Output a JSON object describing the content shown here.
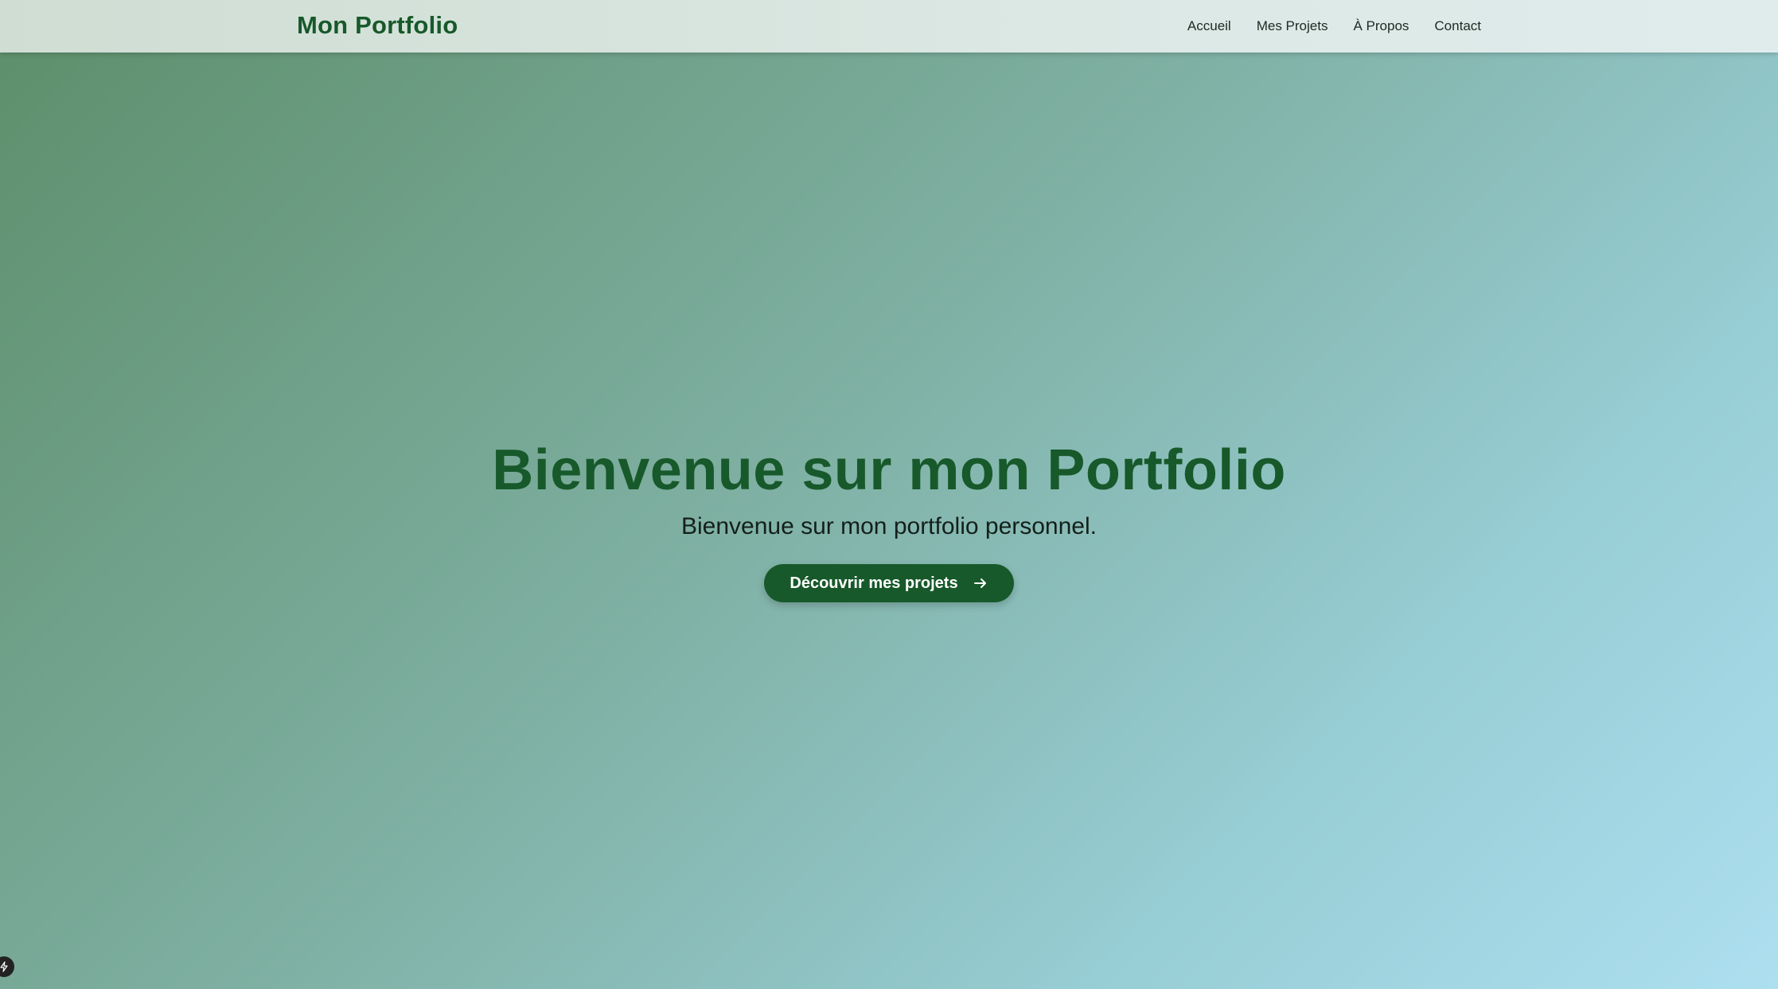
{
  "header": {
    "brand": "Mon Portfolio",
    "nav": [
      {
        "label": "Accueil"
      },
      {
        "label": "Mes Projets"
      },
      {
        "label": "À Propos"
      },
      {
        "label": "Contact"
      }
    ]
  },
  "hero": {
    "title": "Bienvenue sur mon Portfolio",
    "subtitle": "Bienvenue sur mon portfolio personnel.",
    "cta_label": "Découvrir mes projets",
    "cta_icon": "arrow-right-icon"
  },
  "badge": {
    "icon": "lightning-icon"
  },
  "colors": {
    "brand_green": "#17592a",
    "gradient_start": "#5d8e6a",
    "gradient_end": "#addff0",
    "navbar_bg": "#dce8e4"
  }
}
